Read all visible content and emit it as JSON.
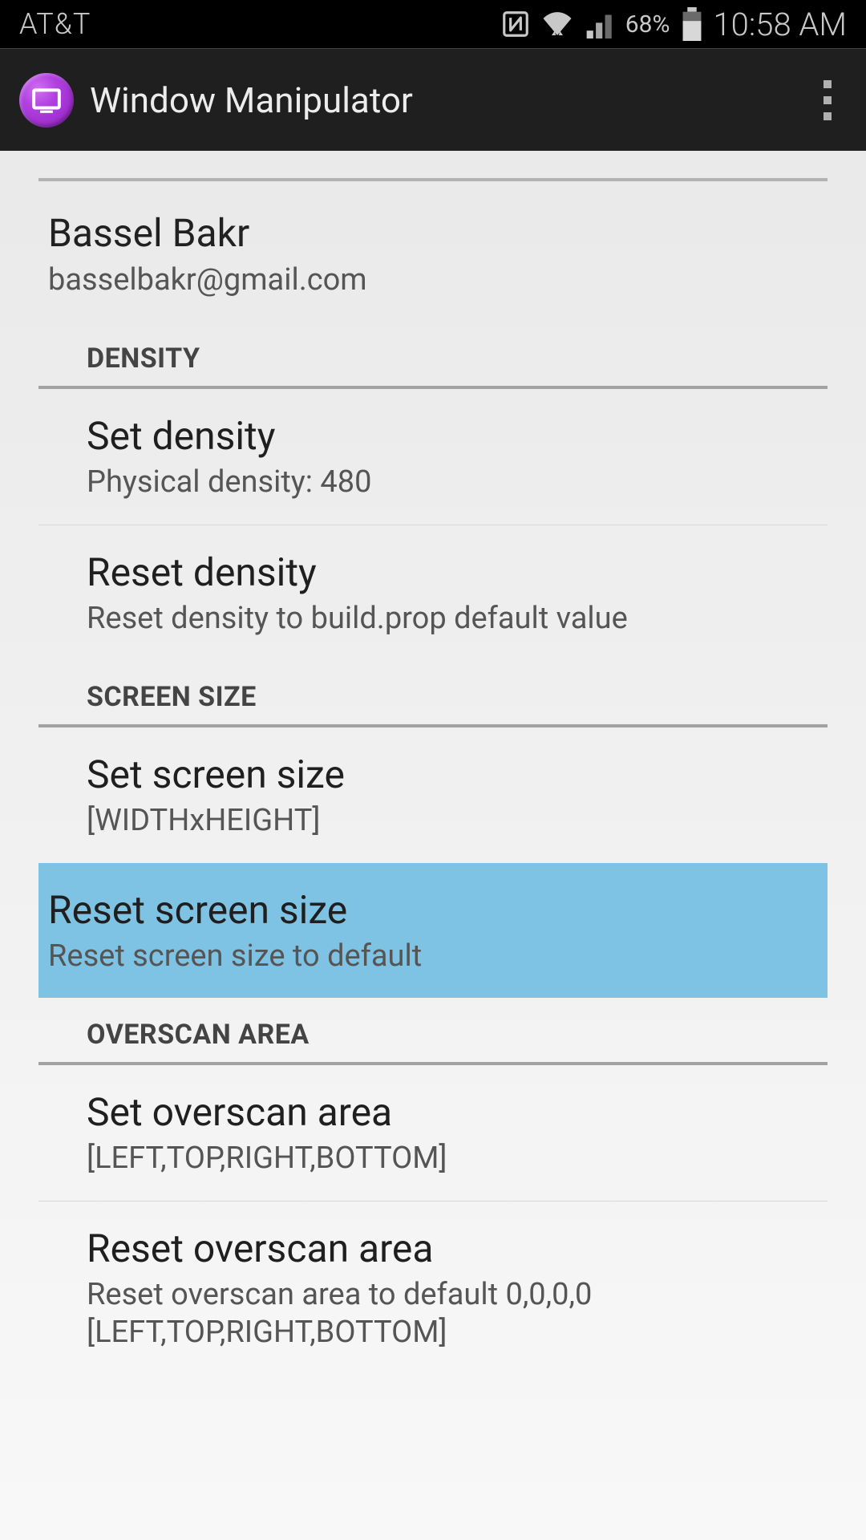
{
  "status_bar": {
    "carrier": "AT&T",
    "battery_percent": "68%",
    "time": "10:58 AM"
  },
  "app_bar": {
    "title": "Window Manipulator"
  },
  "author": {
    "name": "Bassel Bakr",
    "email": "basselbakr@gmail.com"
  },
  "sections": {
    "density": {
      "header": "DENSITY",
      "set": {
        "title": "Set density",
        "subtitle": "Physical density: 480"
      },
      "reset": {
        "title": "Reset density",
        "subtitle": "Reset density to build.prop default value"
      }
    },
    "screen_size": {
      "header": "SCREEN SIZE",
      "set": {
        "title": "Set screen size",
        "subtitle": " [WIDTHxHEIGHT]"
      },
      "reset": {
        "title": "Reset screen size",
        "subtitle": "Reset screen size to default"
      }
    },
    "overscan": {
      "header": "OVERSCAN AREA",
      "set": {
        "title": "Set overscan area",
        "subtitle": "[LEFT,TOP,RIGHT,BOTTOM]"
      },
      "reset": {
        "title": "Reset overscan area",
        "subtitle": "Reset overscan area to default 0,0,0,0 [LEFT,TOP,RIGHT,BOTTOM]"
      }
    }
  }
}
